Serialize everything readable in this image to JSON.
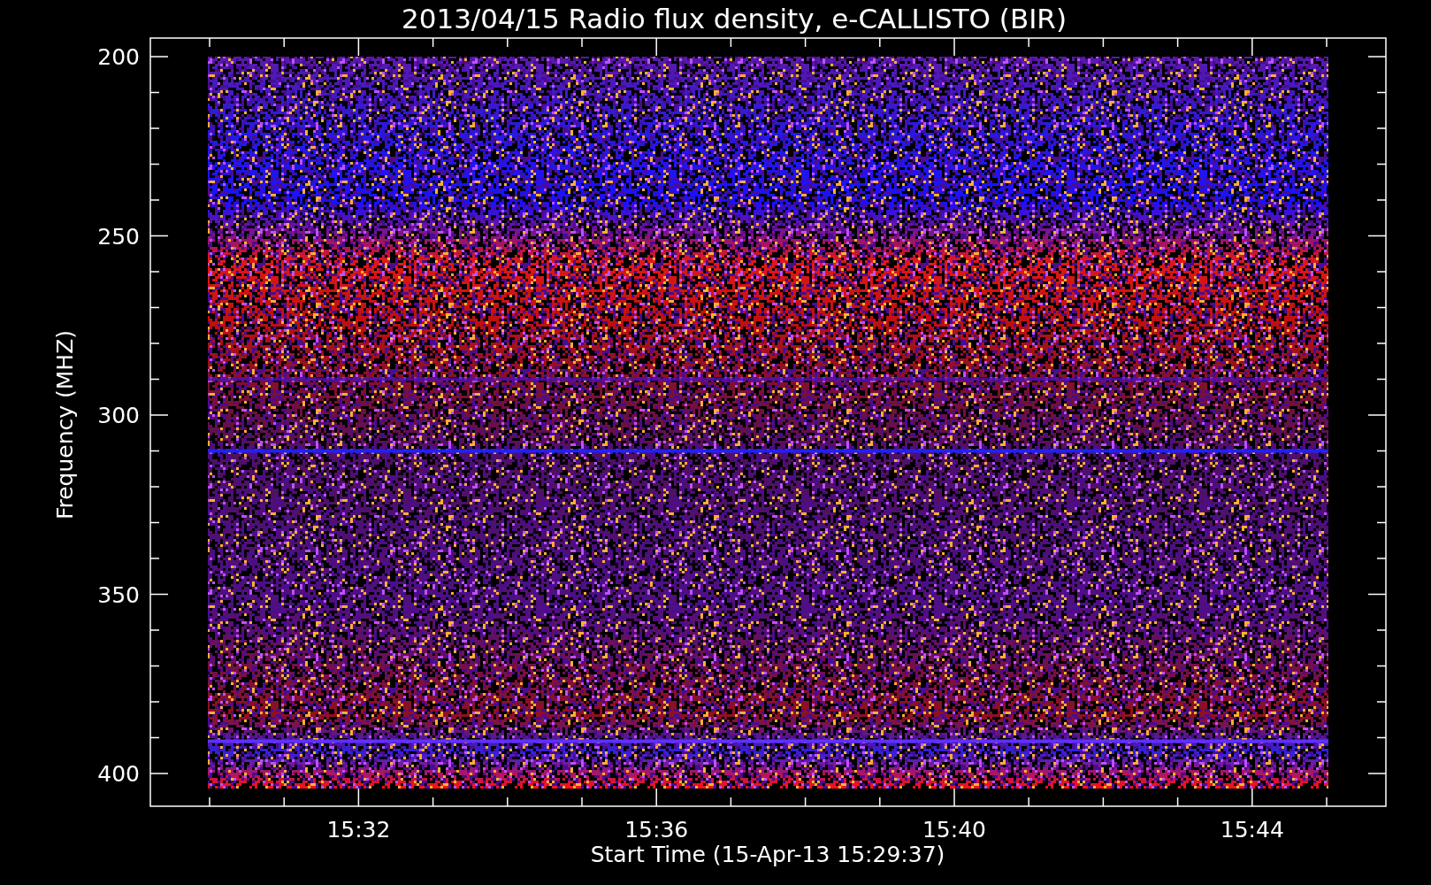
{
  "title": "2013/04/15  Radio flux density, e-CALLISTO (BIR)",
  "y_axis": {
    "label": "Frequency (MHZ)",
    "ticks": [
      "200",
      "250",
      "300",
      "350",
      "400"
    ]
  },
  "x_axis": {
    "label": "Start Time (15-Apr-13 15:29:37)",
    "ticks": [
      "15:32",
      "15:36",
      "15:40",
      "15:44"
    ]
  }
}
